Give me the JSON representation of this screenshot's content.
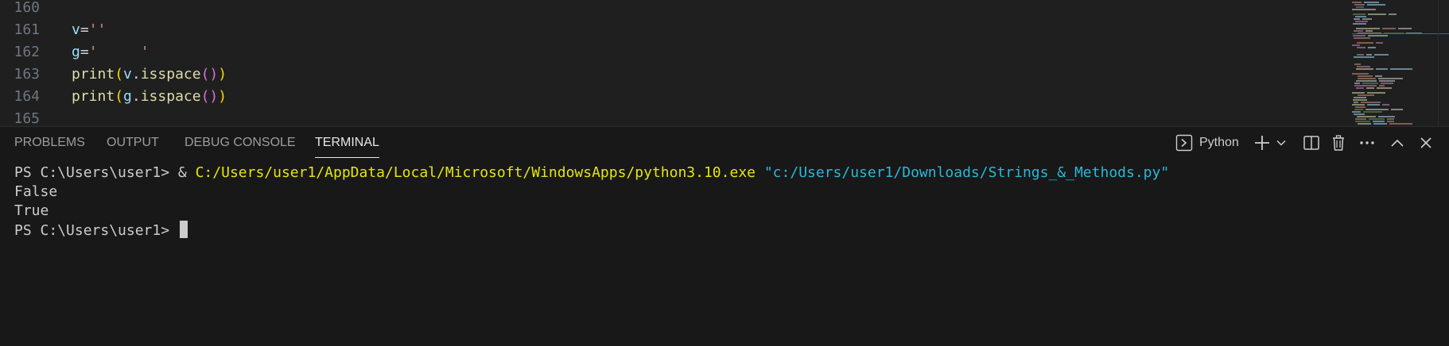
{
  "editor": {
    "lines": [
      {
        "number": "160",
        "tokens": []
      },
      {
        "number": "161",
        "tokens": [
          {
            "t": "v",
            "c": "var"
          },
          {
            "t": "=",
            "c": "op"
          },
          {
            "t": "''",
            "c": "str"
          }
        ]
      },
      {
        "number": "162",
        "tokens": [
          {
            "t": "g",
            "c": "var"
          },
          {
            "t": "=",
            "c": "op"
          },
          {
            "t": "'     '",
            "c": "str"
          }
        ]
      },
      {
        "number": "163",
        "tokens": [
          {
            "t": "print",
            "c": "fn"
          },
          {
            "t": "(",
            "c": "p1"
          },
          {
            "t": "v",
            "c": "var"
          },
          {
            "t": ".",
            "c": "op"
          },
          {
            "t": "isspace",
            "c": "fn"
          },
          {
            "t": "()",
            "c": "p2"
          },
          {
            "t": ")",
            "c": "p1"
          }
        ]
      },
      {
        "number": "164",
        "tokens": [
          {
            "t": "print",
            "c": "fn"
          },
          {
            "t": "(",
            "c": "p1"
          },
          {
            "t": "g",
            "c": "var"
          },
          {
            "t": ".",
            "c": "op"
          },
          {
            "t": "isspace",
            "c": "fn"
          },
          {
            "t": "()",
            "c": "p2"
          },
          {
            "t": ")",
            "c": "p1"
          }
        ]
      },
      {
        "number": "165",
        "tokens": []
      }
    ]
  },
  "panel": {
    "tabs": [
      {
        "label": "PROBLEMS",
        "active": false
      },
      {
        "label": "OUTPUT",
        "active": false
      },
      {
        "label": "DEBUG CONSOLE",
        "active": false
      },
      {
        "label": "TERMINAL",
        "active": true
      }
    ],
    "actions": {
      "profile_label": "Python",
      "icons": [
        "terminal-profile-icon",
        "add-terminal-icon",
        "chevron-down-icon",
        "split-terminal-icon",
        "trash-icon",
        "more-actions-icon",
        "maximize-panel-icon",
        "close-panel-icon"
      ]
    }
  },
  "terminal": {
    "prompt": "PS C:\\Users\\user1> ",
    "command_amp": "& ",
    "command_exe": "C:/Users/user1/AppData/Local/Microsoft/WindowsApps/python3.10.exe",
    "command_arg": "\"c:/Users/user1/Downloads/Strings_&_Methods.py\"",
    "output": [
      "False",
      "True"
    ],
    "final_prompt": "PS C:\\Users\\user1> "
  },
  "colors": {
    "editor_bg": "#1f1f1f",
    "panel_bg": "#181818",
    "keyword_var": "#9cdcfe",
    "string": "#ce9178",
    "function": "#dcdcaa",
    "bracket_1": "#ffd700",
    "bracket_2": "#da70d6",
    "terminal_exe": "#e5e510",
    "terminal_arg": "#29b8db"
  }
}
